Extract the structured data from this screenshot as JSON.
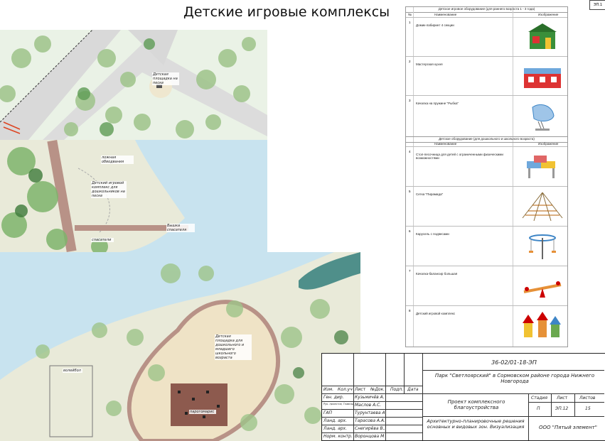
{
  "page": {
    "title": "Детские игровые комплексы",
    "sheet_mark": "ЭП.1"
  },
  "map_labels": {
    "sand_playground": "Детская площадка на песке",
    "lighting": "ложная обводвания",
    "kids_complex": "Детский игровой комплекс для дошкольников на песке",
    "tower": "Вышка спасателя",
    "walkway": "спасатели",
    "school_playground": "Детская площадка для дошкольного и младшего школьного возраста",
    "sports": "волейбол",
    "trees_area": "парогомарис"
  },
  "equipment": {
    "section1_title": "Детское игровое оборудование (для раннего возраста 1 - 3 года)",
    "section2_title": "Детское оборудование (для дошкольного и школьного возраста)",
    "col_num": "№",
    "col_name": "Наименование",
    "col_image": "Изображение",
    "items": [
      {
        "num": "1",
        "name": "Домик-лабиринт 4 секции",
        "icon": "playhouse-image"
      },
      {
        "num": "2",
        "name": "Мастерская кухня",
        "icon": "kitchen-image"
      },
      {
        "num": "3",
        "name": "Качалка на пружине \"Рыбка\"",
        "icon": "spring-rocker-image"
      },
      {
        "num": "4",
        "name": "Стол-песочница для детей с ограниченными физическими возможностями",
        "icon": "sand-table-image"
      },
      {
        "num": "5",
        "name": "Сетка \"Пирамида\"",
        "icon": "rope-pyramid-image"
      },
      {
        "num": "6",
        "name": "Карусель с подвесами",
        "icon": "carousel-image"
      },
      {
        "num": "7",
        "name": "Качалка-балансир большая",
        "icon": "seesaw-image"
      },
      {
        "num": "8",
        "name": "Детский игровой комплекс",
        "icon": "play-complex-image"
      }
    ]
  },
  "stamp": {
    "code": "36-02/01-18-ЭП",
    "project": "Парк \"Светлоярский\" в Сормовском районе города Нижнего Новгорода",
    "headers": [
      "Изм.",
      "Кол.уч",
      "Лист",
      "№Док.",
      "Подп.",
      "Дата"
    ],
    "roles": [
      {
        "role": "Ген. дир.",
        "name": "Кузьмичёв А.Н."
      },
      {
        "role": "Рук. проектов, Главный архит.",
        "name": "Маслов А.С."
      },
      {
        "role": "ГАП",
        "name": "Турунтаева А.В."
      },
      {
        "role": "Ланд. арх.",
        "name": "Тарасова А.А."
      },
      {
        "role": "Ланд. арх.",
        "name": "Снегирёва В.А."
      },
      {
        "role": "Норм. контр.",
        "name": "Воронцова М.А."
      }
    ],
    "design_title": "Проект комплексного благоустройства",
    "stage_label": "Стадия",
    "sheet_label": "Лист",
    "sheets_label": "Листов",
    "stage": "П",
    "sheet": "ЭП.12",
    "sheets": "15",
    "doc_title": "Архитектурно-планировочные решения основных и видовых зон. Визуализация",
    "company": "ООО \"Пятый элемент\""
  }
}
